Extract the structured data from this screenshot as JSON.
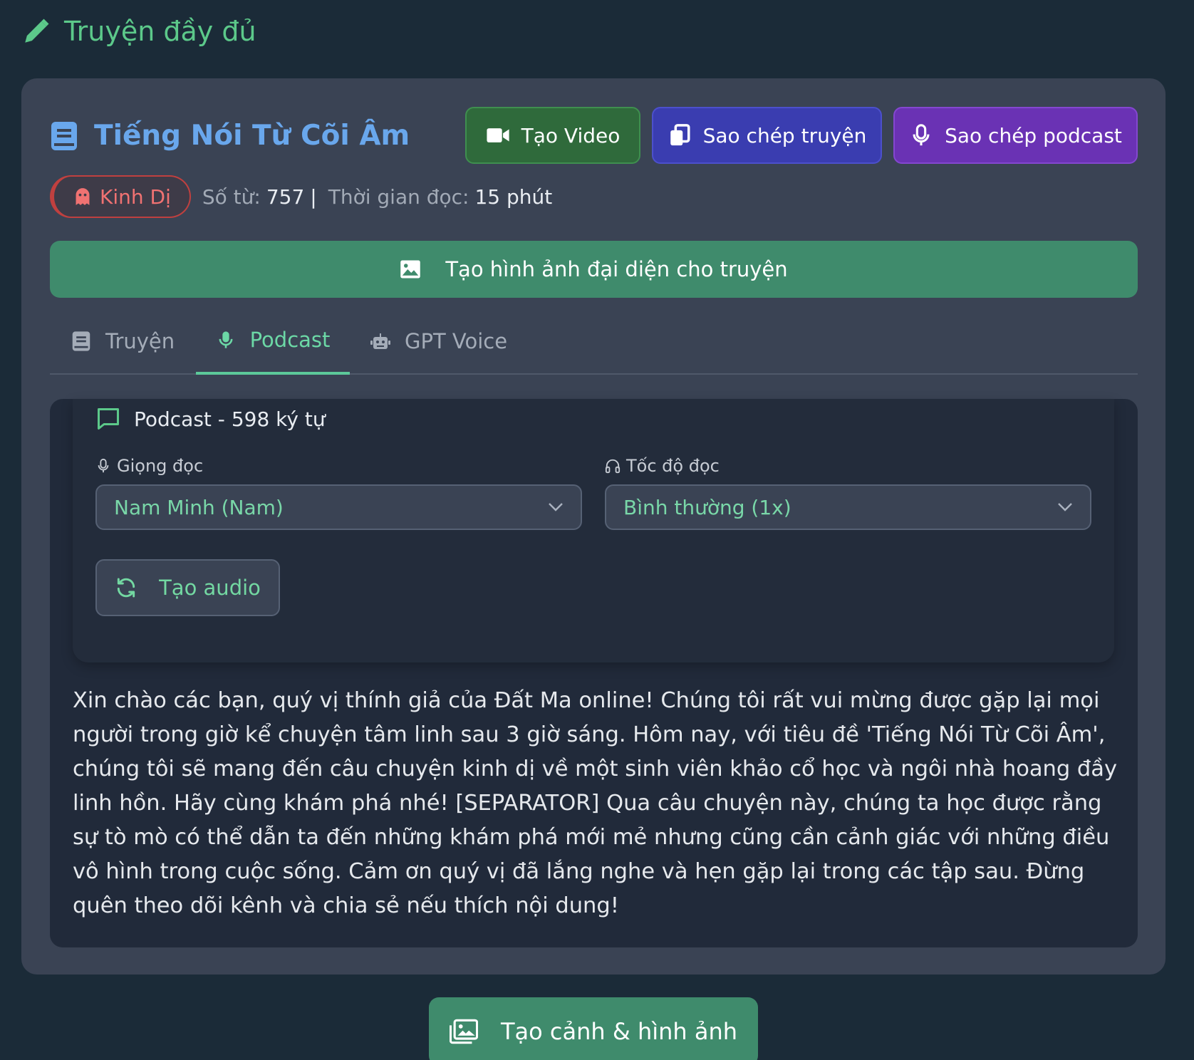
{
  "section": {
    "title": "Truyện đầy đủ",
    "icon": "pencil-icon"
  },
  "story": {
    "title": "Tiếng Nói Từ Cõi Âm",
    "title_icon": "book-icon",
    "actions": {
      "video": "Tạo Video",
      "copy_story": "Sao chép truyện",
      "copy_podcast": "Sao chép podcast"
    },
    "genre": "Kinh Dị",
    "word_count_label": "Số từ:",
    "word_count": "757",
    "separator": "|",
    "read_time_label": "Thời gian đọc:",
    "read_time": "15 phút",
    "create_image": "Tạo hình ảnh đại diện cho truyện"
  },
  "tabs": [
    {
      "label": "Truyện",
      "icon": "book-icon",
      "active": false
    },
    {
      "label": "Podcast",
      "icon": "microphone-icon",
      "active": true
    },
    {
      "label": "GPT Voice",
      "icon": "robot-icon",
      "active": false
    }
  ],
  "podcast": {
    "header": "Podcast - 598 ký tự",
    "voice_label": "Giọng đọc",
    "voice_value": "Nam Minh (Nam)",
    "speed_label": "Tốc độ đọc",
    "speed_value": "Bình thường (1x)",
    "audio_button": "Tạo audio",
    "text": "Xin chào các bạn, quý vị thính giả của Đất Ma online! Chúng tôi rất vui mừng được gặp lại mọi người trong giờ kể chuyện tâm linh sau 3 giờ sáng. Hôm nay, với tiêu đề 'Tiếng Nói Từ Cõi Âm', chúng tôi sẽ mang đến câu chuyện kinh dị về một sinh viên khảo cổ học và ngôi nhà hoang đầy linh hồn. Hãy cùng khám phá nhé! [SEPARATOR] Qua câu chuyện này, chúng ta học được rằng sự tò mò có thể dẫn ta đến những khám phá mới mẻ nhưng cũng cần cảnh giác với những điều vô hình trong cuộc sống. Cảm ơn quý vị đã lắng nghe và hẹn gặp lại trong các tập sau. Đừng quên theo dõi kênh và chia sẻ nếu thích nội dung!"
  },
  "bottom_button": "Tạo cảnh & hình ảnh",
  "colors": {
    "background": "#1b2b38",
    "accent_green": "#5cc98a",
    "title_blue": "#69a7ec",
    "video_btn": "#2f6a3b",
    "copy_btn": "#3a3db0",
    "podcast_btn": "#6a32b4",
    "genre_red": "#f07272"
  }
}
